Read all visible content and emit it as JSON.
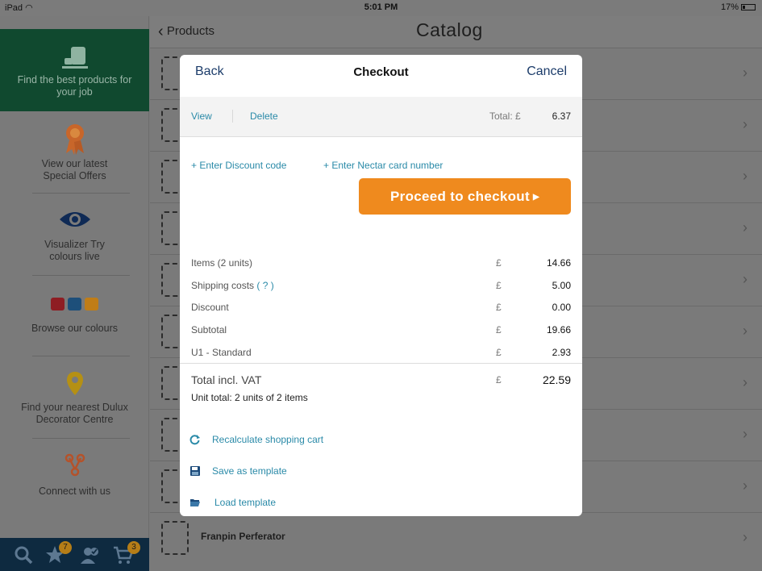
{
  "status_bar": {
    "device": "iPad",
    "time": "5:01 PM",
    "battery": "17%"
  },
  "sidebar": {
    "items": [
      {
        "label": "Find the best products for your job"
      },
      {
        "label": "View our latest Special Offers"
      },
      {
        "label": "Visualizer Try colours live"
      },
      {
        "label": "Browse our colours"
      },
      {
        "label": "Find your nearest Dulux Decorator Centre"
      },
      {
        "label": "Connect with us"
      }
    ],
    "favorites_count": "7",
    "cart_count": "3"
  },
  "navbar": {
    "back_label": "Products",
    "title": "Catalog"
  },
  "list": {
    "last_item_title": "Franpin Perferator"
  },
  "modal": {
    "back_label": "Back",
    "title": "Checkout",
    "cancel_label": "Cancel",
    "view_label": "View",
    "delete_label": "Delete",
    "total_label": "Total: £",
    "total_value": "6.37",
    "discount_link": "+ Enter Discount code",
    "nectar_link": "+ Enter Nectar card number",
    "checkout_button": "Proceed to checkout",
    "summary": [
      {
        "label": "Items (2 units)",
        "currency": "£",
        "value": "14.66"
      },
      {
        "label": "Shipping costs",
        "help": "( ? )",
        "currency": "£",
        "value": "5.00"
      },
      {
        "label": "Discount",
        "currency": "£",
        "value": "0.00"
      },
      {
        "label": "Subtotal",
        "currency": "£",
        "value": "19.66"
      },
      {
        "label": "U1 - Standard",
        "currency": "£",
        "value": "2.93"
      }
    ],
    "grand_total": {
      "label": "Total incl. VAT",
      "currency": "£",
      "value": "22.59"
    },
    "unit_total": "Unit total: 2 units of 2 items",
    "actions": {
      "recalculate": "Recalculate shopping cart",
      "save_template": "Save as template",
      "load_template": "Load template"
    }
  },
  "colors": {
    "accent_blue": "#2a8aa8",
    "checkout_orange": "#ef8a1e",
    "sidebar_active": "#10492f",
    "bottom_bar": "#0e2a40",
    "badge": "#b57d17"
  }
}
